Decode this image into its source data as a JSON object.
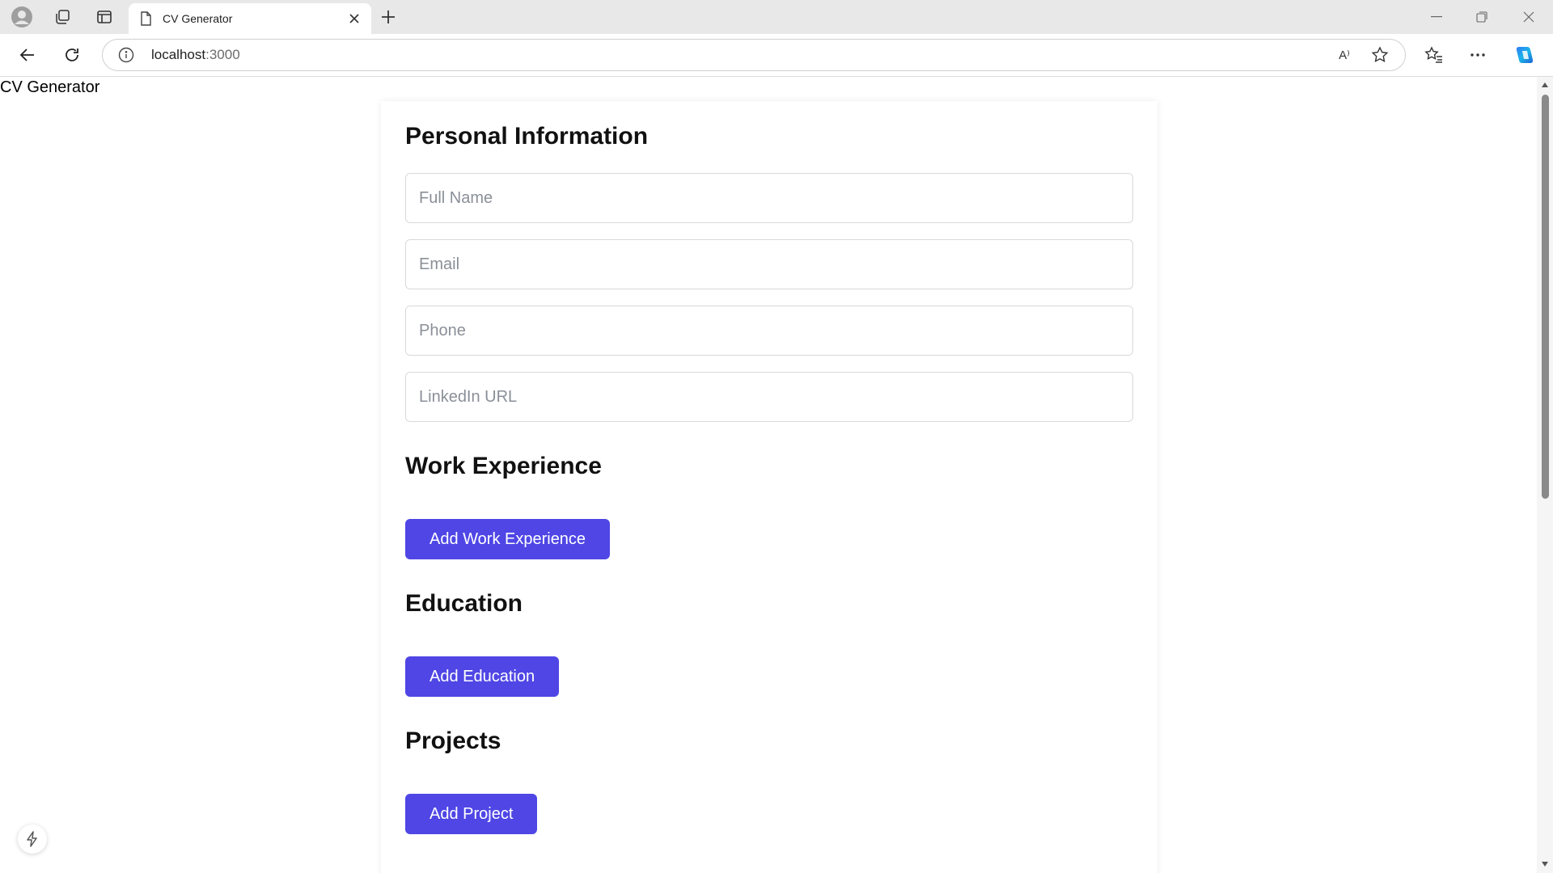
{
  "browser": {
    "tab_title": "CV Generator",
    "url_host": "localhost",
    "url_port": ":3000",
    "read_aloud_label": "A⁾"
  },
  "page": {
    "app_title": "CV Generator",
    "personal": {
      "heading": "Personal Information",
      "full_name_placeholder": "Full Name",
      "email_placeholder": "Email",
      "phone_placeholder": "Phone",
      "linkedin_placeholder": "LinkedIn URL"
    },
    "work": {
      "heading": "Work Experience",
      "add_label": "Add Work Experience"
    },
    "education": {
      "heading": "Education",
      "add_label": "Add Education"
    },
    "projects": {
      "heading": "Projects",
      "add_label": "Add Project"
    }
  },
  "colors": {
    "accent": "#4f46e5"
  }
}
